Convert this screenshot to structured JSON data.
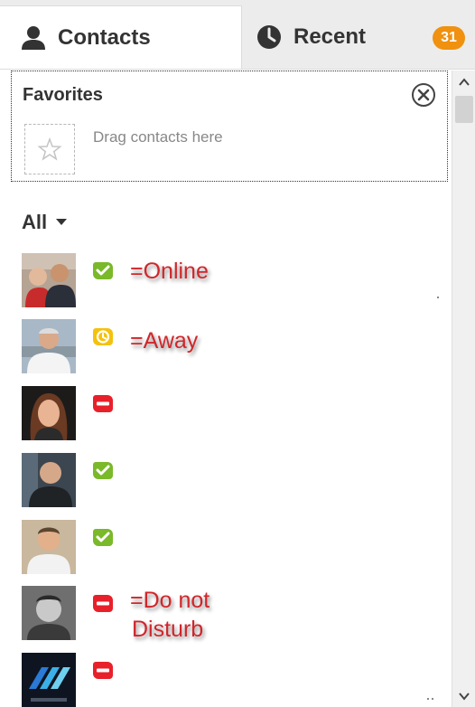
{
  "tabs": {
    "contacts_label": "Contacts",
    "recent_label": "Recent",
    "recent_badge": "31"
  },
  "favorites": {
    "title": "Favorites",
    "hint": "Drag contacts here"
  },
  "filter": {
    "label": "All"
  },
  "contacts": [
    {
      "status": "online",
      "note": "=Online"
    },
    {
      "status": "away",
      "note": "=Away"
    },
    {
      "status": "do-not-disturb",
      "note": ""
    },
    {
      "status": "online",
      "note": ""
    },
    {
      "status": "online",
      "note": ""
    },
    {
      "status": "do-not-disturb",
      "note_line1": "=Do not",
      "note_line2": "Disturb"
    },
    {
      "status": "do-not-disturb",
      "note": ""
    }
  ],
  "colors": {
    "online": "#7ab929",
    "away": "#f4c20d",
    "do_not_disturb": "#e8202a",
    "badge": "#f0910f",
    "annotation": "#d0262b"
  }
}
